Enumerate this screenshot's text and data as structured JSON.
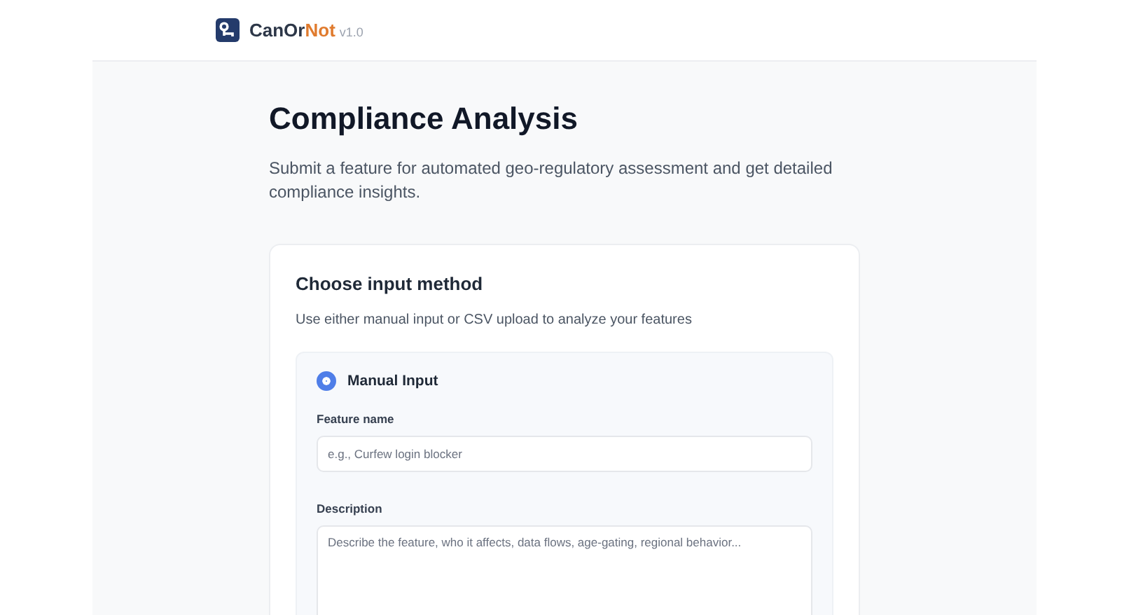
{
  "header": {
    "brand_start": "CanOr",
    "brand_end": "Not",
    "version": "v1.0"
  },
  "page": {
    "title": "Compliance Analysis",
    "subtitle": "Submit a feature for automated geo-regulatory assessment and get detailed compliance insights."
  },
  "card": {
    "title": "Choose input method",
    "description": "Use either manual input or CSV upload to analyze your features",
    "method": {
      "label": "Manual Input",
      "selected": true
    },
    "fields": [
      {
        "kind": "input",
        "label": "Feature name",
        "placeholder": "e.g., Curfew login blocker"
      },
      {
        "kind": "textarea",
        "label": "Description",
        "placeholder": "Describe the feature, who it affects, data flows, age-gating, regional behavior..."
      }
    ]
  }
}
